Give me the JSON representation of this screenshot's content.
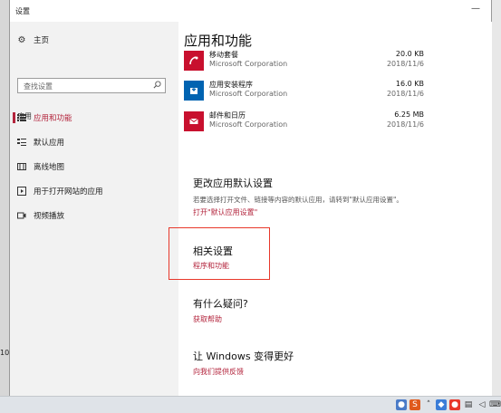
{
  "window": {
    "title": "设置"
  },
  "sidebar": {
    "home_label": "主页",
    "search_placeholder": "查找设置",
    "section_label": "应用",
    "items": [
      {
        "label": "应用和功能",
        "icon": "apps-features-icon"
      },
      {
        "label": "默认应用",
        "icon": "default-apps-icon"
      },
      {
        "label": "离线地图",
        "icon": "offline-maps-icon"
      },
      {
        "label": "用于打开网站的应用",
        "icon": "apps-for-websites-icon"
      },
      {
        "label": "视频播放",
        "icon": "video-playback-icon"
      }
    ]
  },
  "main": {
    "title": "应用和功能",
    "apps": [
      {
        "name": "移动套餐",
        "publisher": "Microsoft Corporation",
        "size": "20.0 KB",
        "date": "2018/11/6",
        "tile_color": "#c8102e"
      },
      {
        "name": "应用安装程序",
        "publisher": "Microsoft Corporation",
        "size": "16.0 KB",
        "date": "2018/11/6",
        "tile_color": "#0063b1"
      },
      {
        "name": "邮件和日历",
        "publisher": "Microsoft Corporation",
        "size": "6.25 MB",
        "date": "2018/11/6",
        "tile_color": "#c8102e"
      }
    ],
    "default_settings": {
      "heading": "更改应用默认设置",
      "description": "若要选择打开文件、链接等内容的默认应用，请转到\"默认应用设置\"。",
      "link": "打开\"默认应用设置\""
    },
    "related": {
      "heading": "相关设置",
      "link": "程序和功能"
    },
    "question": {
      "heading": "有什么疑问?",
      "link": "获取帮助"
    },
    "improve": {
      "heading": "让 Windows 变得更好",
      "link": "向我们提供反馈"
    }
  },
  "colors": {
    "accent": "#b3243c",
    "highlight": "#e8382b"
  }
}
